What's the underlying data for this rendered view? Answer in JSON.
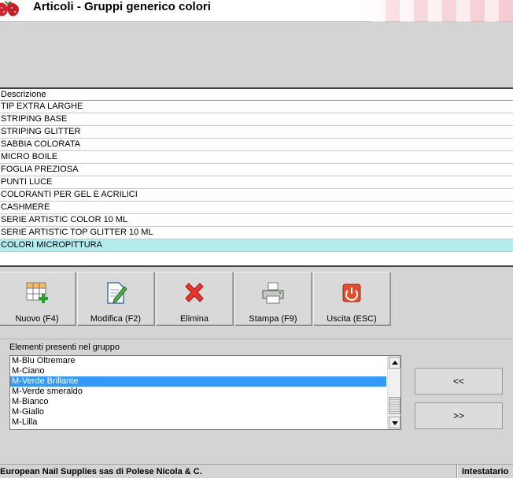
{
  "window": {
    "title": "Articoli - Gruppi generico colori"
  },
  "grid": {
    "header": "Descrizione",
    "rows": [
      "TIP EXTRA LARGHE",
      "STRIPING BASE",
      "STRIPING GLITTER",
      "SABBIA COLORATA",
      "MICRO BOILE",
      "FOGLIA PREZIOSA",
      "PUNTI LUCE",
      "COLORANTI PER GEL E ACRILICI",
      "CASHMERE",
      "SERIE ARTISTIC COLOR  10 ML",
      "SERIE ARTISTIC TOP GLITTER  10 ML",
      "COLORI MICROPITTURA"
    ],
    "selected_row": "COLORI MICROPITTURA"
  },
  "toolbar": {
    "new_label": "Nuovo (F4)",
    "edit_label": "Modifica (F2)",
    "delete_label": "Elimina",
    "print_label": "Stampa (F9)",
    "exit_label": "Uscita (ESC)"
  },
  "group": {
    "label": "Elementi presenti nel gruppo",
    "items": [
      "M-Blu Oltremare",
      "M-Ciano",
      "M-Verde Brillante",
      "M-Verde smeraldo",
      "M-Bianco",
      "M-Giallo",
      "M-Lilla"
    ],
    "selected_item": "M-Verde Brillante"
  },
  "move": {
    "add_label": "<<",
    "remove_label": ">>"
  },
  "status": {
    "company": "European Nail Supplies sas di Polese Nicola & C.",
    "owner_label": "Intestatario"
  },
  "colors": {
    "selected_row": "#b4ecee",
    "selected_item": "#3399ff",
    "background": "#d4d4d4"
  },
  "icons": {
    "app": "strawberry-icon",
    "new": "grid-add-icon",
    "edit": "document-pencil-icon",
    "delete": "red-x-icon",
    "print": "printer-icon",
    "exit": "power-icon"
  }
}
